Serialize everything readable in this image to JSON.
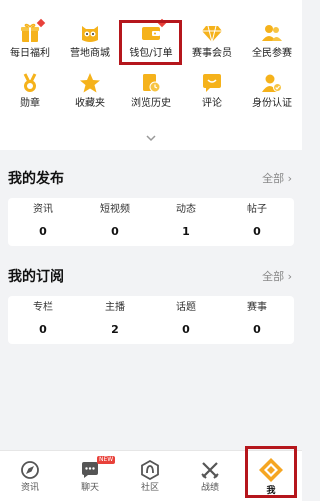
{
  "grid": {
    "items": [
      {
        "label": "每日福利",
        "icon": "gift-icon",
        "dot": true
      },
      {
        "label": "营地商城",
        "icon": "owl-mascot-icon",
        "dot": false
      },
      {
        "label": "钱包/订单",
        "icon": "wallet-icon",
        "dot": true
      },
      {
        "label": "赛事会员",
        "icon": "diamond-icon",
        "dot": false
      },
      {
        "label": "全民参赛",
        "icon": "people-icon",
        "dot": false
      },
      {
        "label": "勋章",
        "icon": "medal-icon",
        "dot": false
      },
      {
        "label": "收藏夹",
        "icon": "star-icon",
        "dot": false
      },
      {
        "label": "浏览历史",
        "icon": "history-icon",
        "dot": false
      },
      {
        "label": "评论",
        "icon": "comment-icon",
        "dot": false
      },
      {
        "label": "身份认证",
        "icon": "id-verify-icon",
        "dot": false
      }
    ]
  },
  "publish": {
    "title": "我的发布",
    "all": "全部",
    "stats": [
      {
        "label": "资讯",
        "value": "0"
      },
      {
        "label": "短视频",
        "value": "0"
      },
      {
        "label": "动态",
        "value": "1"
      },
      {
        "label": "帖子",
        "value": "0"
      }
    ]
  },
  "subscribe": {
    "title": "我的订阅",
    "all": "全部",
    "stats": [
      {
        "label": "专栏",
        "value": "0"
      },
      {
        "label": "主播",
        "value": "2"
      },
      {
        "label": "话题",
        "value": "0"
      },
      {
        "label": "赛事",
        "value": "0"
      }
    ]
  },
  "nav": {
    "tabs": [
      {
        "label": "资讯",
        "icon": "news-icon"
      },
      {
        "label": "聊天",
        "icon": "chat-icon",
        "badge": "NEW"
      },
      {
        "label": "社区",
        "icon": "community-icon"
      },
      {
        "label": "战绩",
        "icon": "crossed-swords-icon"
      },
      {
        "label": "我",
        "icon": "me-icon"
      }
    ]
  },
  "colors": {
    "accent": "#f5a623",
    "highlight": "#b5161c",
    "badge": "#e8413a"
  }
}
